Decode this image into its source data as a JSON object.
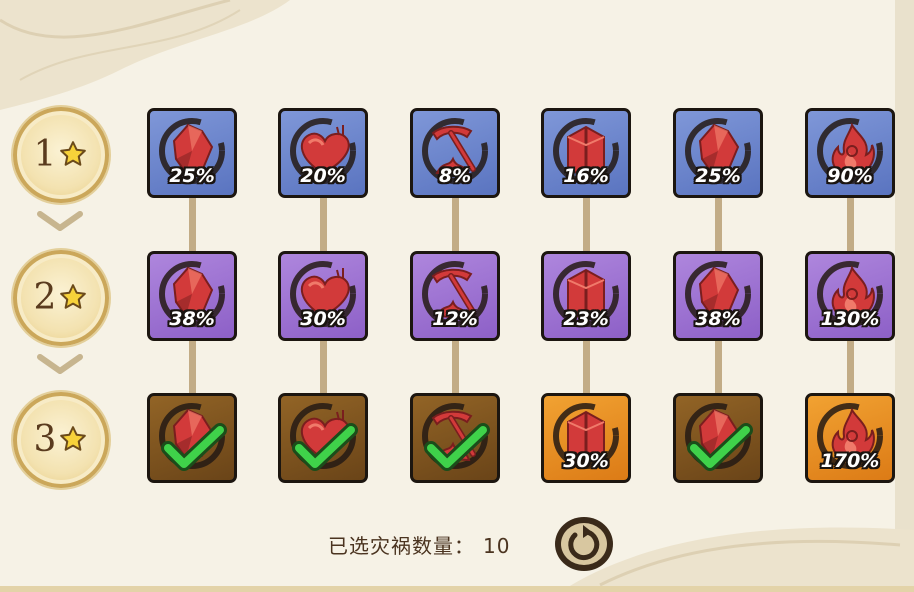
{
  "tiers": [
    {
      "number": "1",
      "icon": "star-icon"
    },
    {
      "number": "2",
      "icon": "star-icon"
    },
    {
      "number": "3",
      "icon": "star-icon"
    }
  ],
  "columns": [
    {
      "icon": "shield-crystal-icon"
    },
    {
      "icon": "heart-icon"
    },
    {
      "icon": "pickaxe-icon"
    },
    {
      "icon": "fortress-icon"
    },
    {
      "icon": "shield-crystal-icon"
    },
    {
      "icon": "flame-icon"
    }
  ],
  "grid": {
    "row1": [
      {
        "value": "25%",
        "color": "blue"
      },
      {
        "value": "20%",
        "color": "blue"
      },
      {
        "value": "8%",
        "color": "blue"
      },
      {
        "value": "16%",
        "color": "blue"
      },
      {
        "value": "25%",
        "color": "blue"
      },
      {
        "value": "90%",
        "color": "blue"
      }
    ],
    "row2": [
      {
        "value": "38%",
        "color": "purple"
      },
      {
        "value": "30%",
        "color": "purple"
      },
      {
        "value": "12%",
        "color": "purple"
      },
      {
        "value": "23%",
        "color": "purple"
      },
      {
        "value": "38%",
        "color": "purple"
      },
      {
        "value": "130%",
        "color": "purple"
      }
    ],
    "row3": [
      {
        "value": "",
        "color": "brown",
        "selected": true
      },
      {
        "value": "",
        "color": "brown",
        "selected": true
      },
      {
        "value": "",
        "color": "brown",
        "selected": true
      },
      {
        "value": "30%",
        "color": "orange",
        "selected": false
      },
      {
        "value": "",
        "color": "brown",
        "selected": true
      },
      {
        "value": "170%",
        "color": "orange",
        "selected": false
      }
    ]
  },
  "footer": {
    "label": "已选灾祸数量：",
    "count": "10",
    "reset_icon": "reset-arrow-icon"
  },
  "colors": {
    "background": "#f6f2e6",
    "tier_blue": "#6a83cc",
    "tier_purple": "#9c72d2",
    "tier_brown": "#7d5520",
    "tier_orange": "#e88e22",
    "icon_red": "#d23a3a",
    "check_green": "#3fd24a"
  }
}
